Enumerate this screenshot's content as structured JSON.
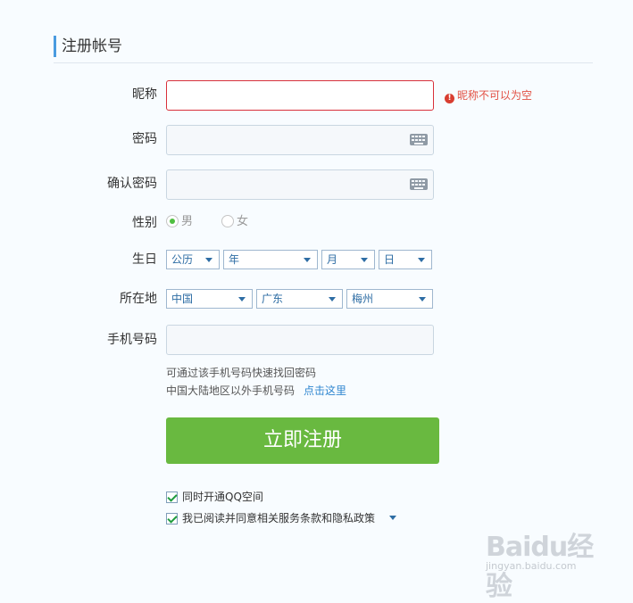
{
  "header": {
    "title": "注册帐号"
  },
  "form": {
    "nickname_label": "昵称",
    "nickname_value": "",
    "nickname_error": "昵称不可以为空",
    "password_label": "密码",
    "confirm_label": "确认密码",
    "gender_label": "性别",
    "gender_male": "男",
    "gender_female": "女",
    "gender_selected": "男",
    "birthday_label": "生日",
    "calendar": "公历",
    "year": "年",
    "month": "月",
    "day": "日",
    "location_label": "所在地",
    "country": "中国",
    "province": "广东",
    "city": "梅州",
    "phone_label": "手机号码",
    "phone_hint1": "可通过该手机号码快速找回密码",
    "phone_hint2": "中国大陆地区以外手机号码",
    "phone_link": "点击这里",
    "submit": "立即注册",
    "option_qzone": "同时开通QQ空间",
    "option_agree": "我已阅读并同意相关服务条款和隐私政策"
  },
  "watermark": {
    "brand": "Baidu经验",
    "url": "jingyan.baidu.com"
  },
  "colors": {
    "accent": "#4a9be0",
    "button": "#69b940",
    "error": "#d8303b",
    "link": "#2f86d0"
  }
}
